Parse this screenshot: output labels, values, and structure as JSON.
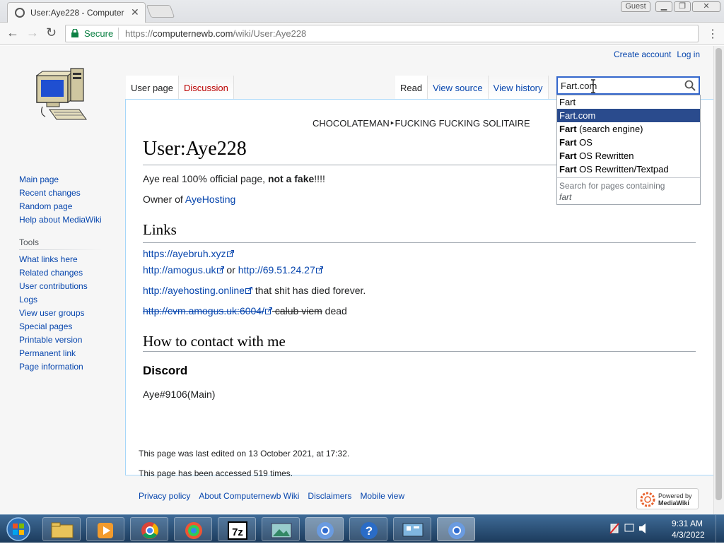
{
  "browser": {
    "tab_title": "User:Aye228 - Computer",
    "guest_label": "Guest",
    "secure_label": "Secure",
    "url_scheme": "https://",
    "url_host": "computernewb.com",
    "url_path": "/wiki/User:Aye228"
  },
  "wiki": {
    "personal": {
      "create_account": "Create account",
      "log_in": "Log in"
    },
    "tabs_left": [
      "User page",
      "Discussion"
    ],
    "tabs_right": [
      "Read",
      "View source",
      "View history"
    ],
    "search_value": "Fart.com",
    "breadcrumb": "CHOCOLATEMAN‣FUCKING FUCKING SOLITAIRE",
    "title": "User:Aye228",
    "intro_text": "Aye real 100% official page, ",
    "intro_bold": "not a fake",
    "intro_tail": "!!!!",
    "owner_prefix": "Owner of ",
    "owner_link": "AyeHosting",
    "links_heading": "Links",
    "links": {
      "l1": "https://ayebruh.xyz",
      "l2a": "http://amogus.uk",
      "l2_or": " or ",
      "l2b": "http://69.51.24.27",
      "l3": "http://ayehosting.online",
      "l3_tail": " that shit has died forever.",
      "l4": "http://cvm.amogus.uk:6004/",
      "l4_strike": " calub viem",
      "l4_tail": " dead"
    },
    "contact_heading": "How to contact with me",
    "discord_heading": "Discord",
    "discord_id": "Aye#9106(Main)",
    "sidebar_nav": [
      "Main page",
      "Recent changes",
      "Random page",
      "Help about MediaWiki"
    ],
    "tools_heading": "Tools",
    "tools": [
      "What links here",
      "Related changes",
      "User contributions",
      "Logs",
      "View user groups",
      "Special pages",
      "Printable version",
      "Permanent link",
      "Page information"
    ],
    "footer_info1": "This page was last edited on 13 October 2021, at 17:32.",
    "footer_info2": "This page has been accessed 519 times.",
    "footer_links": [
      "Privacy policy",
      "About Computernewb Wiki",
      "Disclaimers",
      "Mobile view"
    ],
    "powered_line1": "Powered by",
    "powered_line2": "MediaWiki"
  },
  "suggestions": {
    "items": [
      {
        "bold": "",
        "rest": "Fart",
        "active": false
      },
      {
        "bold": "",
        "rest": "Fart.com",
        "active": true
      },
      {
        "bold": "Fart",
        "rest": " (search engine)",
        "active": false
      },
      {
        "bold": "Fart",
        "rest": " OS",
        "active": false
      },
      {
        "bold": "Fart",
        "rest": " OS Rewritten",
        "active": false
      },
      {
        "bold": "Fart",
        "rest": " OS Rewritten/Textpad",
        "active": false
      }
    ],
    "special_label": "Search for pages containing",
    "special_term": "fart"
  },
  "taskbar": {
    "time": "9:31 AM",
    "date": "4/3/2022",
    "items": [
      "explorer",
      "media-player",
      "chrome",
      "color-app",
      "7zip",
      "image-viewer",
      "chrome",
      "help",
      "control-panel",
      "chrome"
    ]
  }
}
